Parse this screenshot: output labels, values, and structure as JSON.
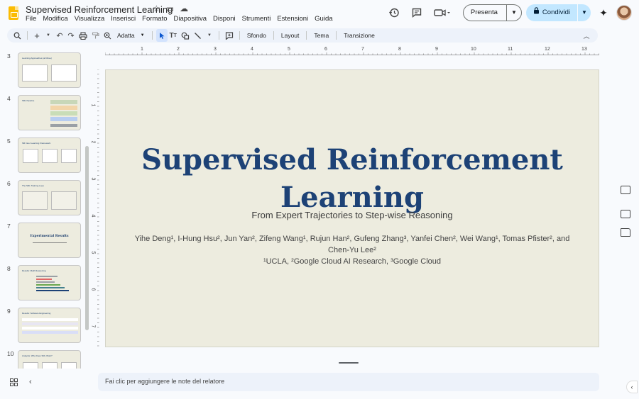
{
  "app": {
    "doc_title": "Supervised Reinforcement Learning",
    "menu": [
      "File",
      "Modifica",
      "Visualizza",
      "Inserisci",
      "Formato",
      "Diapositiva",
      "Disponi",
      "Strumenti",
      "Estensioni",
      "Guida"
    ],
    "present_label": "Presenta",
    "share_label": "Condividi"
  },
  "toolbar": {
    "zoom_label": "Adatta",
    "background_label": "Sfondo",
    "layout_label": "Layout",
    "theme_label": "Tema",
    "transition_label": "Transizione"
  },
  "filmstrip": {
    "slides": [
      {
        "num": "3",
        "title": "Learning Approaches (all three)"
      },
      {
        "num": "4",
        "title": "SRL Pipeline"
      },
      {
        "num": "5",
        "title": "SR Inner Learning Framework"
      },
      {
        "num": "6",
        "title": "The SRL Training Loop"
      },
      {
        "num": "7",
        "title": "Experimental Results"
      },
      {
        "num": "8",
        "title": "Results: Math Reasoning"
      },
      {
        "num": "9",
        "title": "Results: Software Engineering"
      },
      {
        "num": "10",
        "title": "Analysis: Why Does SRL Work?"
      }
    ]
  },
  "rulers": {
    "horizontal": [
      "1",
      "2",
      "3",
      "4",
      "5",
      "6",
      "7",
      "8",
      "9",
      "10",
      "11",
      "12",
      "13"
    ],
    "vertical": [
      "1",
      "2",
      "3",
      "4",
      "5",
      "6",
      "7"
    ]
  },
  "slide": {
    "title": "Supervised Reinforcement Learning",
    "subtitle": "From Expert Trajectories to Step-wise Reasoning",
    "authors": "Yihe Deng¹, I-Hung Hsu², Jun Yan², Zifeng Wang¹, Rujun Han², Gufeng Zhang³, Yanfei Chen², Wei Wang¹, Tomas Pfister², and Chen-Yu Lee²",
    "affiliations": "¹UCLA, ²Google Cloud AI Research, ³Google Cloud"
  },
  "notes": {
    "placeholder": "Fai clic per aggiungere le note del relatore"
  },
  "colors": {
    "slide_bg": "#edecdf",
    "title_blue": "#1d4276",
    "share_bg": "#c2e7ff",
    "toolbar_bg": "#edf2fa"
  }
}
